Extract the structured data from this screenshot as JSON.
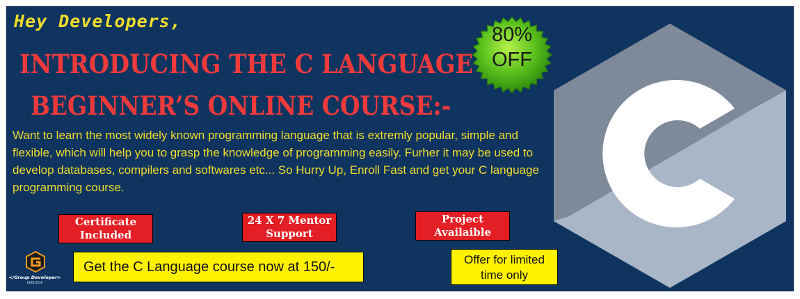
{
  "banner": {
    "greeting": "Hey Developers,",
    "headline_line1": "INTRODUCING THE C LANGUAGE",
    "headline_line2": "BEGINNER’S ONLINE COURSE:-",
    "description": "Want to learn the most widely known programming language that is extremly popular, simple and flexible, which will help you to grasp the knowledge of programming easily. Furher it may be used to develop databases, compilers and softwares etc... So Hurry Up, Enroll Fast  and get your C language programming course.",
    "features": [
      {
        "line1": "Certificate",
        "line2": "Included"
      },
      {
        "line1": "24 X 7 Mentor",
        "line2": "Support"
      },
      {
        "line1": "Project",
        "line2": "Availaible"
      }
    ],
    "cta": "Get the C Language course now at 150/-",
    "offer_line1": "Offer for limited",
    "offer_line2": "time only",
    "badge_line1": "80%",
    "badge_line2": "OFF",
    "logo_letter": "C",
    "brand_name": "</Group Developer>",
    "brand_estd": "ESTD 2019"
  },
  "colors": {
    "background": "#0f3460",
    "headline": "#ef3a3c",
    "accent_yellow": "#f2dc2c",
    "feature_red": "#e31e24",
    "cta_yellow": "#fff200",
    "badge_green": "#5cc21e",
    "hex_dark": "#7e8a99",
    "hex_light": "#a8b6c8",
    "brand_orange": "#f39a1e"
  }
}
